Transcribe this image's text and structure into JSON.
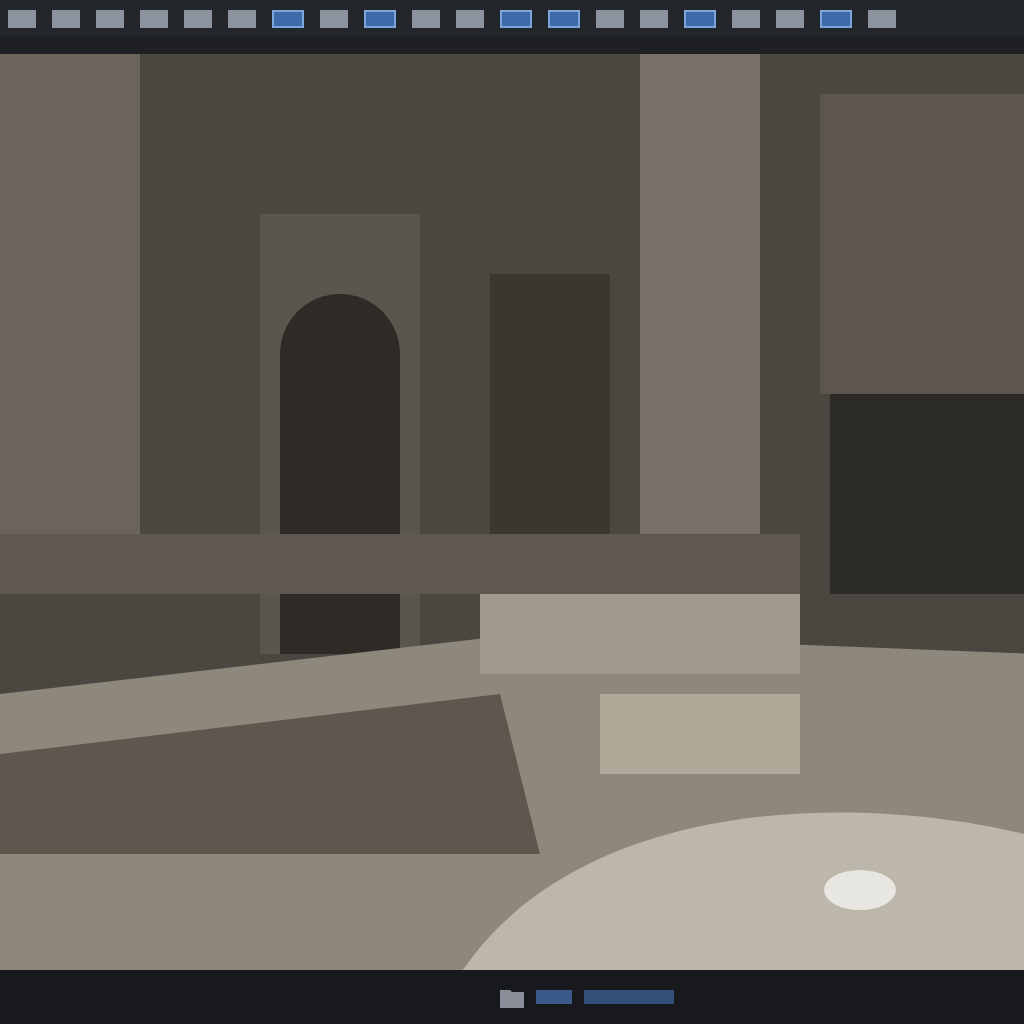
{
  "toolbar": {
    "buttons": [
      {
        "selected": false
      },
      {
        "selected": false
      },
      {
        "selected": false
      },
      {
        "selected": false
      },
      {
        "selected": false
      },
      {
        "selected": false
      },
      {
        "selected": true
      },
      {
        "selected": false
      },
      {
        "selected": true
      },
      {
        "selected": false
      },
      {
        "selected": false
      },
      {
        "selected": true
      },
      {
        "selected": true
      },
      {
        "selected": false
      },
      {
        "selected": false
      },
      {
        "selected": true
      },
      {
        "selected": false
      },
      {
        "selected": false
      },
      {
        "selected": true
      },
      {
        "selected": false
      }
    ]
  }
}
